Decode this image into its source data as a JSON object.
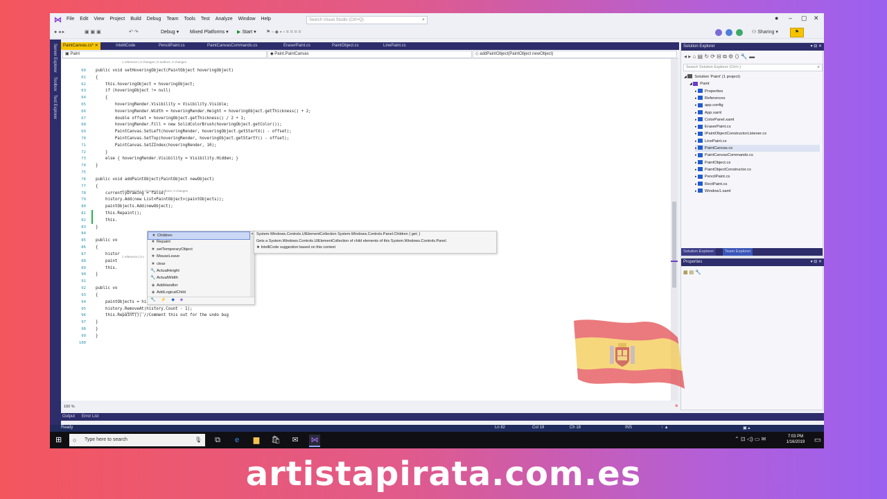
{
  "titlebar": {
    "menu": [
      "File",
      "Edit",
      "View",
      "Project",
      "Build",
      "Debug",
      "Team",
      "Tools",
      "Test",
      "Analyze",
      "Window",
      "Help"
    ],
    "search_placeholder": "Search Visual Studio (Ctrl+Q)"
  },
  "toolbar": {
    "config": "Debug",
    "platform": "Mixed Platforms",
    "start": "Start",
    "sharing": "Sharing"
  },
  "left_strip": [
    "Server Explorer",
    "Toolbox",
    "Test Explorer"
  ],
  "tabs": [
    "PaintCanvas.cs*",
    "IntelliCode",
    "PencilPaint.cs",
    "PaintCanvasCommands.cs",
    "EraserPaint.cs",
    "PaintObject.cs",
    "LinePaint.cs"
  ],
  "navbar": {
    "project": "Paint",
    "class": "Paint.PaintCanvas",
    "member": "addPaintObject(PaintObject newObject)"
  },
  "code": {
    "lens1": "1 reference | 0 changes | 0 authors, 0 changes",
    "lens2": "2 references | 0 changes | 0 authors, 0 changes",
    "lens3": "1 reference | 0 c",
    "lens4": "1 reference | 0 c",
    "lines": [
      {
        "n": "60",
        "t": "public void setHoveringObject(PaintObject hoveringObject)"
      },
      {
        "n": "61",
        "t": "{"
      },
      {
        "n": "62",
        "t": "    this.hoveringObject = hoveringObject;"
      },
      {
        "n": "63",
        "t": "    if (hoveringObject != null)"
      },
      {
        "n": "64",
        "t": "    {"
      },
      {
        "n": "65",
        "t": "        hoveringRender.Visibility = Visibility.Visible;"
      },
      {
        "n": "66",
        "t": "        hoveringRender.Width = hoveringRender.Height = hoveringObject.getThickness() + 2;"
      },
      {
        "n": "67",
        "t": "        double offset = hoveringObject.getThickness() / 2 + 1;"
      },
      {
        "n": "68",
        "t": "        hoveringRender.Fill = new SolidColorBrush(hoveringObject.getColor());"
      },
      {
        "n": "69",
        "t": "        PaintCanvas.SetLeft(hoveringRender, hoveringObject.getStartX() - offset);"
      },
      {
        "n": "70",
        "t": "        PaintCanvas.SetTop(hoveringRender, hoveringObject.getStartY() - offset);"
      },
      {
        "n": "71",
        "t": "        PaintCanvas.SetZIndex(hoveringRender, 10);"
      },
      {
        "n": "72",
        "t": "    }"
      },
      {
        "n": "73",
        "t": "    else { hoveringRender.Visibility = Visibility.Hidden; }"
      },
      {
        "n": "74",
        "t": "}"
      },
      {
        "n": "75",
        "t": ""
      },
      {
        "n": "76",
        "t": "public void addPaintObject(PaintObject newObject)"
      },
      {
        "n": "77",
        "t": "{"
      },
      {
        "n": "78",
        "t": "    currentlyDrawing = false;"
      },
      {
        "n": "79",
        "t": "    history.Add(new List<PaintObject>(paintObjects));"
      },
      {
        "n": "80",
        "t": "    paintObjects.Add(newObject);"
      },
      {
        "n": "81",
        "t": "    this.Repaint();"
      },
      {
        "n": "82",
        "t": "    this."
      },
      {
        "n": "83",
        "t": "}"
      },
      {
        "n": "84",
        "t": ""
      },
      {
        "n": "85",
        "t": "public vo"
      },
      {
        "n": "86",
        "t": "{"
      },
      {
        "n": "87",
        "t": "    histor                                        ects));"
      },
      {
        "n": "88",
        "t": "    paint"
      },
      {
        "n": "89",
        "t": "    this."
      },
      {
        "n": "90",
        "t": "}"
      },
      {
        "n": "91",
        "t": ""
      },
      {
        "n": "92",
        "t": "public vo"
      },
      {
        "n": "93",
        "t": "{"
      },
      {
        "n": "94",
        "t": "    paintObjects = history.Last<List<PaintObject>>();"
      },
      {
        "n": "95",
        "t": "    history.RemoveAt(history.Count - 1);"
      },
      {
        "n": "96",
        "t": "    this.Repaint(); //Comment this out for the undo bug"
      },
      {
        "n": "97",
        "t": "}"
      },
      {
        "n": "98",
        "t": "}"
      },
      {
        "n": "99",
        "t": "}"
      },
      {
        "n": "100",
        "t": ""
      }
    ]
  },
  "intellisense": {
    "items": [
      {
        "label": "Children",
        "icon": "intellicode-star-icon"
      },
      {
        "label": "Repaint",
        "icon": "intellicode-star-icon"
      },
      {
        "label": "setTemporaryObject",
        "icon": "intellicode-star-icon"
      },
      {
        "label": "MouseLeave",
        "icon": "intellicode-star-icon"
      },
      {
        "label": "clear",
        "icon": "intellicode-star-icon"
      },
      {
        "label": "ActualHeight",
        "icon": "wrench-icon"
      },
      {
        "label": "ActualWidth",
        "icon": "wrench-icon"
      },
      {
        "label": "AddHandler",
        "icon": "method-icon"
      },
      {
        "label": "AddLogicalChild",
        "icon": "method-icon"
      }
    ],
    "tooltip": [
      "System.Windows.Controls.UIElementCollection System.Windows.Controls.Panel.Children { get; }",
      "Gets a System.Windows.Controls.UIElementCollection of child elements of this System.Windows.Controls.Panel.",
      "★ IntelliCode suggestion based on this context"
    ]
  },
  "zoom": "100 %",
  "output_tabs": [
    "Output",
    "Error List"
  ],
  "status": {
    "ready": "Ready",
    "ln": "Ln 82",
    "col": "Col 18",
    "ch": "Ch 18",
    "ins": "INS"
  },
  "taskbar": {
    "search": "Type here to search",
    "time": "7:03 PM",
    "date": "1/16/2019"
  },
  "solution_explorer": {
    "title": "Solution Explorer",
    "search_placeholder": "Search Solution Explorer (Ctrl+;)",
    "nodes": [
      {
        "label": "Solution 'Paint' (1 project)",
        "level": 0
      },
      {
        "label": "Paint",
        "level": 1
      },
      {
        "label": "Properties",
        "level": 2
      },
      {
        "label": "References",
        "level": 2
      },
      {
        "label": "app.config",
        "level": 2
      },
      {
        "label": "App.xaml",
        "level": 2
      },
      {
        "label": "ColorPanel.xaml",
        "level": 2
      },
      {
        "label": "EraserPaint.cs",
        "level": 2
      },
      {
        "label": "IPaintObjectConstructorListener.cs",
        "level": 2
      },
      {
        "label": "LinePaint.cs",
        "level": 2
      },
      {
        "label": "PaintCanvas.cs",
        "level": 2
      },
      {
        "label": "PaintCanvasCommands.cs",
        "level": 2
      },
      {
        "label": "PaintObject.cs",
        "level": 2
      },
      {
        "label": "PaintObjectConstructor.cs",
        "level": 2
      },
      {
        "label": "PencilPaint.cs",
        "level": 2
      },
      {
        "label": "RectPaint.cs",
        "level": 2
      },
      {
        "label": "Window1.xaml",
        "level": 2
      }
    ],
    "tabs": [
      "Solution Explorer",
      "Team Explorer"
    ]
  },
  "properties": {
    "title": "Properties"
  },
  "watermark": "artistapirata.com.es",
  "colors": {
    "accent": "#f5c400",
    "chrome": "#2d2d6b",
    "taskbar": "#101014"
  }
}
